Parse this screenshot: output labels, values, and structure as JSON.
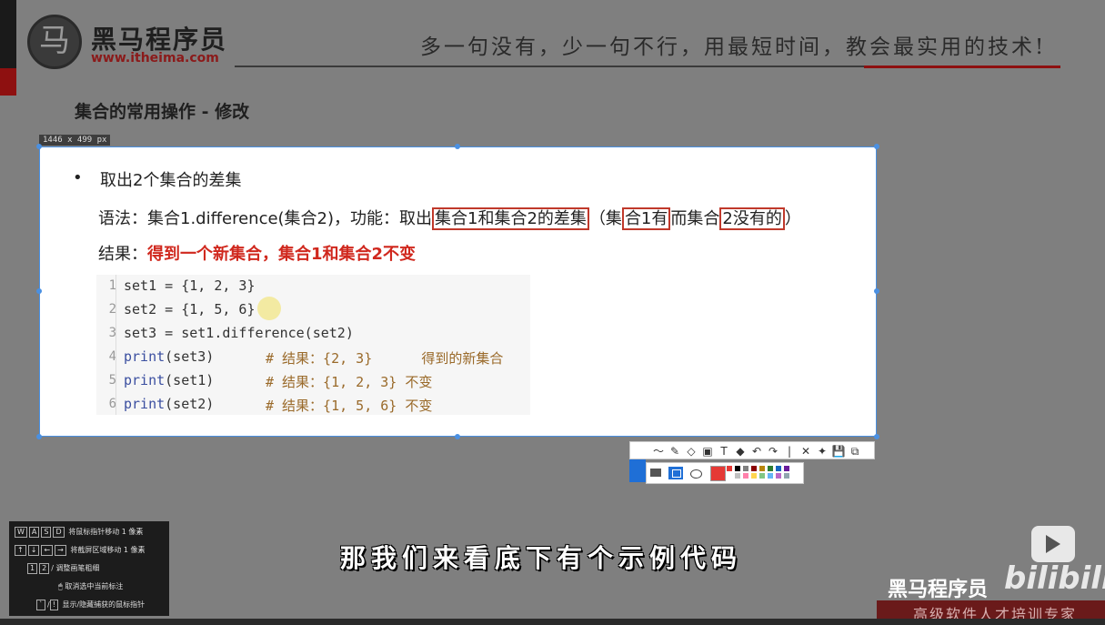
{
  "header": {
    "logo_glyph": "马",
    "brand": "黑马程序员",
    "url": "www.itheima.com",
    "slogan": "多一句没有，少一句不行，用最短时间，教会最实用的技术!"
  },
  "slide": {
    "title": "集合的常用操作 - 修改",
    "capture_size": "1446 x 499  px",
    "bullet": "•",
    "point": "取出2个集合的差集",
    "syntax": {
      "prefix": "语法：集合1.difference(集合2)，功能：取出",
      "hl1": "集合1和集合2的差集",
      "mid1": "（集",
      "hl2": "合1有",
      "mid2": "而集合",
      "hl3": "2没有的",
      "suffix": "）"
    },
    "result": {
      "label": "结果：",
      "text": "得到一个新集合，集合1和集合2不变"
    }
  },
  "code": {
    "lines": [
      {
        "n": "1",
        "code": "set1 = {1, 2, 3}",
        "comment": ""
      },
      {
        "n": "2",
        "code": "set2 = {1, 5, 6}",
        "comment": ""
      },
      {
        "n": "3",
        "code": "set3 = set1.difference(set2)",
        "comment": ""
      },
      {
        "n": "4",
        "kw": "print",
        "code": "(set3)",
        "comment": "# 结果：{2, 3}      得到的新集合"
      },
      {
        "n": "5",
        "kw": "print",
        "code": "(set1)",
        "comment": "# 结果：{1, 2, 3} 不变"
      },
      {
        "n": "6",
        "kw": "print",
        "code": "(set2)",
        "comment": "# 结果：{1, 5, 6} 不变"
      }
    ]
  },
  "toolbar": {
    "tools": [
      "〜",
      "✎",
      "◇",
      "▣",
      "T",
      "◆",
      "↶",
      "↷",
      "|",
      "✕",
      "✦",
      "💾",
      "⧉"
    ],
    "colors": [
      "#e53935",
      "#000000",
      "#7f7f7f",
      "#8b0000",
      "#b8860b",
      "#2e7d32",
      "#1565c0",
      "#6a1b9a",
      "#ffffff",
      "#c0c0c0",
      "#ff80ab",
      "#ffd54f",
      "#81c784",
      "#64b5f6",
      "#ba68c8",
      "#90a4ae"
    ]
  },
  "help": {
    "rows": [
      {
        "keys": [
          "W",
          "A",
          "S",
          "D"
        ],
        "text": "将鼠标指针移动 1 像素"
      },
      {
        "keys": [
          "↑",
          "↓",
          "←",
          "→"
        ],
        "text": "将截屏区域移动 1 像素"
      },
      {
        "keys": [
          "1",
          "2",
          "/"
        ],
        "text": "调整画笔粗细"
      },
      {
        "keys": [
          "🖱"
        ],
        "text": "取消选中当前标注"
      },
      {
        "keys": [
          "`",
          "/",
          "!"
        ],
        "text": "显示/隐藏捕获的鼠标指针"
      }
    ]
  },
  "subtitle": "那我们来看底下有个示例代码",
  "footer": {
    "brand": "黑马程序员",
    "bili": "bilibili",
    "tagline": "高级软件人才培训专家"
  }
}
